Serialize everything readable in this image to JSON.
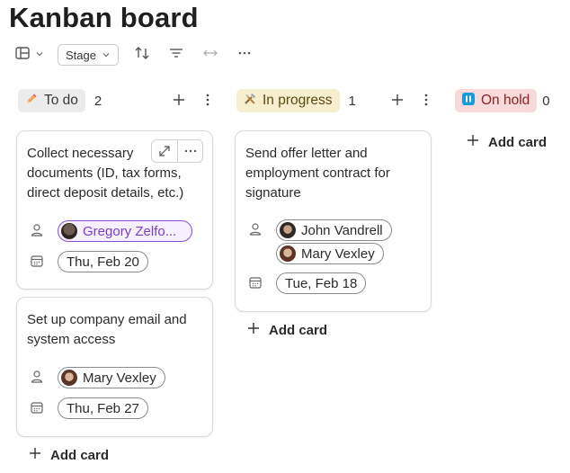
{
  "page": {
    "title": "Kanban board"
  },
  "toolbar": {
    "view_icon": "board-view-icon",
    "stage_label": "Stage",
    "sort_icon": "sort-icon",
    "filter_icon": "filter-icon",
    "width_icon": "column-width-icon",
    "more_icon": "more-options-icon"
  },
  "columns": [
    {
      "name": "To do",
      "count": "2",
      "icon": "pencil-icon",
      "color": "#ececec",
      "cards": [
        {
          "title_lines": [
            "Collect necessary",
            "documents (ID, tax forms,",
            "direct deposit details, etc.)"
          ],
          "assignees": [
            "Gregory Zelfo..."
          ],
          "date": "Thu, Feb 20"
        },
        {
          "title_lines": [
            "Set up company email and",
            "system access"
          ],
          "assignees": [
            "Mary Vexley"
          ],
          "date": "Thu, Feb 27"
        }
      ],
      "add_label": "Add card"
    },
    {
      "name": "In progress",
      "count": "1",
      "icon": "tools-icon",
      "color": "#f5efcf",
      "cards": [
        {
          "title_lines": [
            "Send offer letter and",
            "employment contract for",
            "signature"
          ],
          "assignees": [
            "John Vandrell",
            "Mary Vexley"
          ],
          "date": "Tue, Feb 18"
        }
      ],
      "add_label": "Add card"
    },
    {
      "name": "On hold",
      "count": "0",
      "icon": "pause-icon",
      "color": "#f8dada",
      "cards": [],
      "add_label": "Add card"
    }
  ]
}
